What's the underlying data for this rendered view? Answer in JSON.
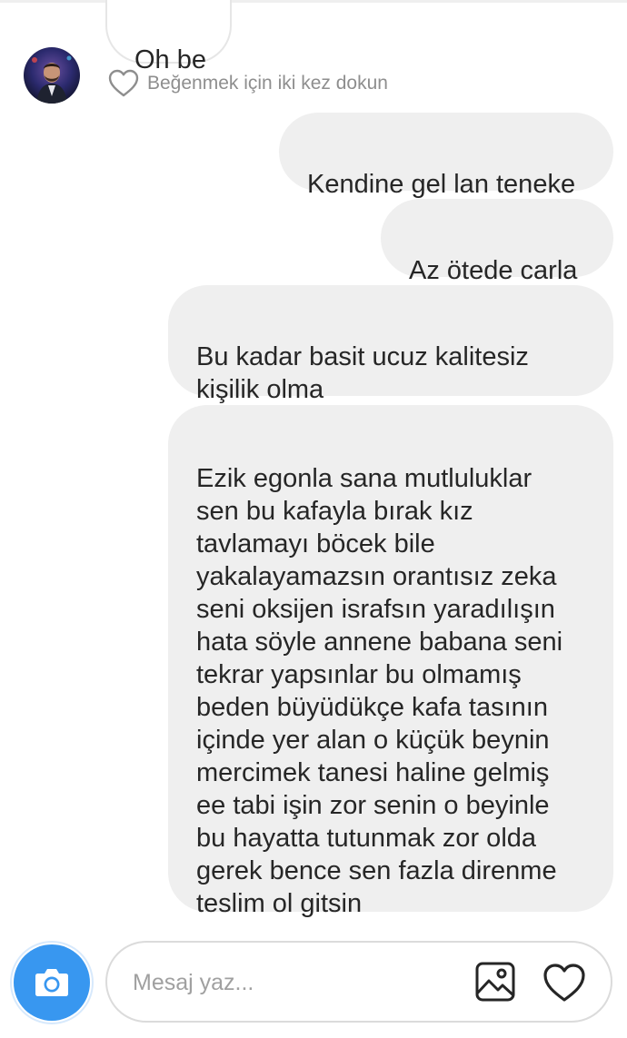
{
  "conversation": {
    "incoming_message": "Oh be",
    "like_hint": "Beğenmek için iki kez dokun",
    "outgoing_messages": [
      "Kendine gel lan teneke",
      "Az ötede carla",
      "Bu kadar basit ucuz kalitesiz\nkişilik olma",
      "Ezik egonla sana mutluluklar\nsen bu kafayla bırak kız\ntavlamayı böcek bile\nyakalayamazsın orantısız zeka\nseni oksijen israfsın yaradılışın\nhata söyle annene babana seni\ntekrar yapsınlar bu olmamış\nbeden büyüdükçe kafa tasının\niçinde yer alan o küçük beynin\nmercimek tanesi haline gelmiş\nee tabi işin zor senin o beyinle\nbu hayatta tutunmak zor olda\ngerek bence sen fazla direnme\nteslim ol gitsin"
    ]
  },
  "composer": {
    "placeholder": "Mesaj yaz...",
    "value": ""
  },
  "colors": {
    "accent": "#3897f0",
    "outgoing_bubble": "#efefef",
    "incoming_border": "#e6e6e6",
    "hint_text": "#8e8e8e"
  },
  "icons": {
    "camera": "camera-icon",
    "gallery": "gallery-icon",
    "like": "heart-icon",
    "like_hint": "heart-outline-icon"
  }
}
